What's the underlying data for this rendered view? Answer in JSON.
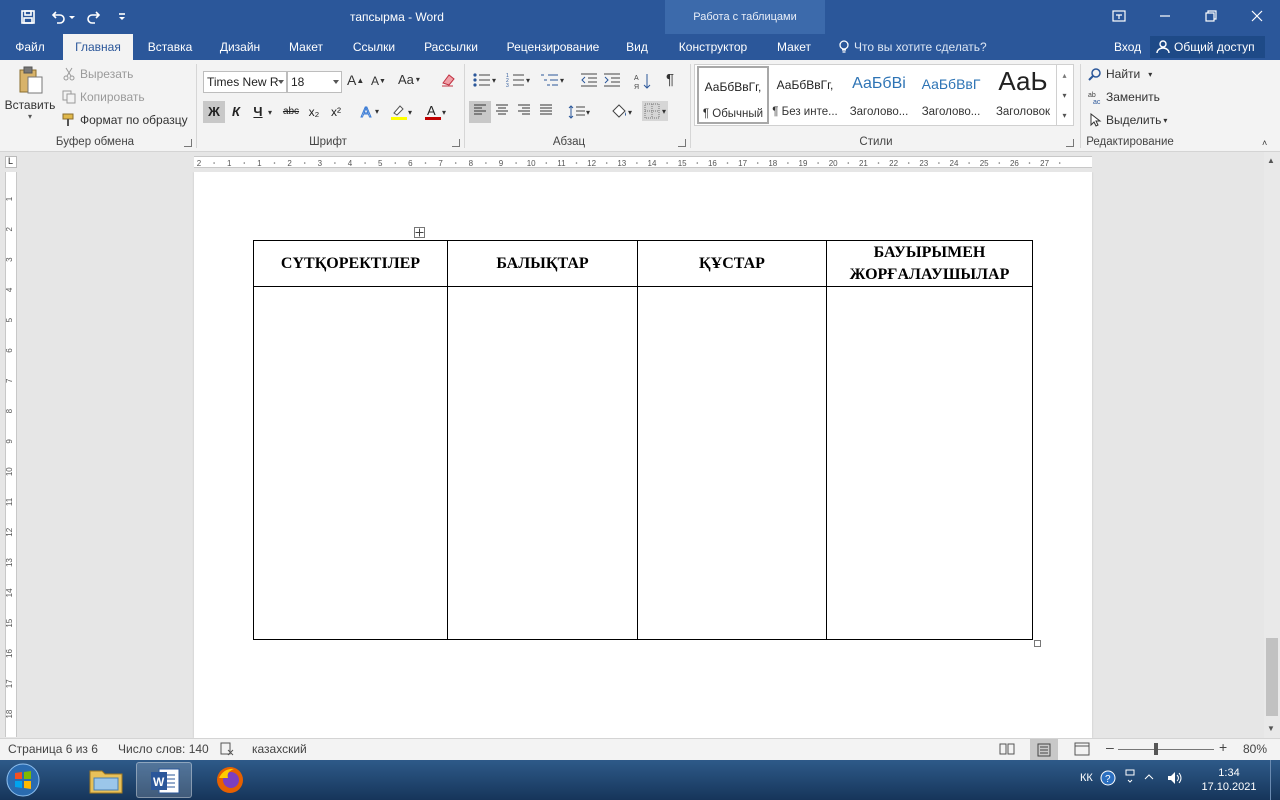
{
  "window": {
    "title": "тапсырма - Word",
    "context_group": "Работа с таблицами"
  },
  "tabs": [
    {
      "label": "Файл"
    },
    {
      "label": "Главная"
    },
    {
      "label": "Вставка"
    },
    {
      "label": "Дизайн"
    },
    {
      "label": "Макет"
    },
    {
      "label": "Ссылки"
    },
    {
      "label": "Рассылки"
    },
    {
      "label": "Рецензирование"
    },
    {
      "label": "Вид"
    },
    {
      "label": "Конструктор"
    },
    {
      "label": "Макет"
    }
  ],
  "active_tab": "Главная",
  "tellme": "Что вы хотите сделать?",
  "login": "Вход",
  "share": "Общий доступ",
  "ribbon": {
    "clipboard": {
      "paste": "Вставить",
      "cut": "Вырезать",
      "copy": "Копировать",
      "format_painter": "Формат по образцу",
      "label": "Буфер обмена"
    },
    "font": {
      "name": "Times New R",
      "size": "18",
      "grow": "A",
      "shrink": "A",
      "case": "Aa",
      "bold": "Ж",
      "italic": "К",
      "underline": "Ч",
      "strike": "abc",
      "sub": "x₂",
      "sup": "x²",
      "label": "Шрифт"
    },
    "paragraph": {
      "label": "Абзац"
    },
    "styles": {
      "items": [
        {
          "preview": "АаБбВвГг,",
          "name": "¶ Обычный"
        },
        {
          "preview": "АаБбВвГг,",
          "name": "¶ Без инте..."
        },
        {
          "preview": "АаБбВі",
          "name": "Заголово..."
        },
        {
          "preview": "АаБбВвГ",
          "name": "Заголово..."
        },
        {
          "preview": "АаЬ",
          "name": "Заголовок"
        }
      ],
      "label": "Стили"
    },
    "editing": {
      "find": "Найти",
      "replace": "Заменить",
      "select": "Выделить",
      "label": "Редактирование"
    }
  },
  "ruler": {
    "h_ticks": [
      "2",
      "1",
      "1",
      "2",
      "3",
      "4",
      "5",
      "6",
      "7",
      "8",
      "9",
      "10",
      "11",
      "12",
      "13",
      "14",
      "15",
      "16",
      "17",
      "18",
      "19",
      "20",
      "21",
      "22",
      "23",
      "24",
      "25",
      "26",
      "27"
    ],
    "v_ticks": [
      "1",
      "2",
      "3",
      "4",
      "5",
      "6",
      "7",
      "8",
      "9",
      "10",
      "11",
      "12",
      "13",
      "14",
      "15",
      "16",
      "17",
      "18"
    ]
  },
  "table": {
    "headers": [
      "СҮТҚОРЕКТІЛЕР",
      "БАЛЫҚТАР",
      "ҚҰСТАР",
      "БАУЫРЫМЕН ЖОРҒАЛАУШЫЛАР"
    ]
  },
  "status": {
    "page": "Страница 6 из 6",
    "words": "Число слов: 140",
    "language": "казахский",
    "zoom": "80%"
  },
  "taskbar": {
    "lang": "КК",
    "time": "1:34",
    "date": "17.10.2021"
  },
  "colors": {
    "accent": "#2b579a",
    "context_tab_bg": "#3c6aab",
    "ribbon_bg": "#f3f3f3",
    "doc_bg": "#e6e6e6"
  }
}
